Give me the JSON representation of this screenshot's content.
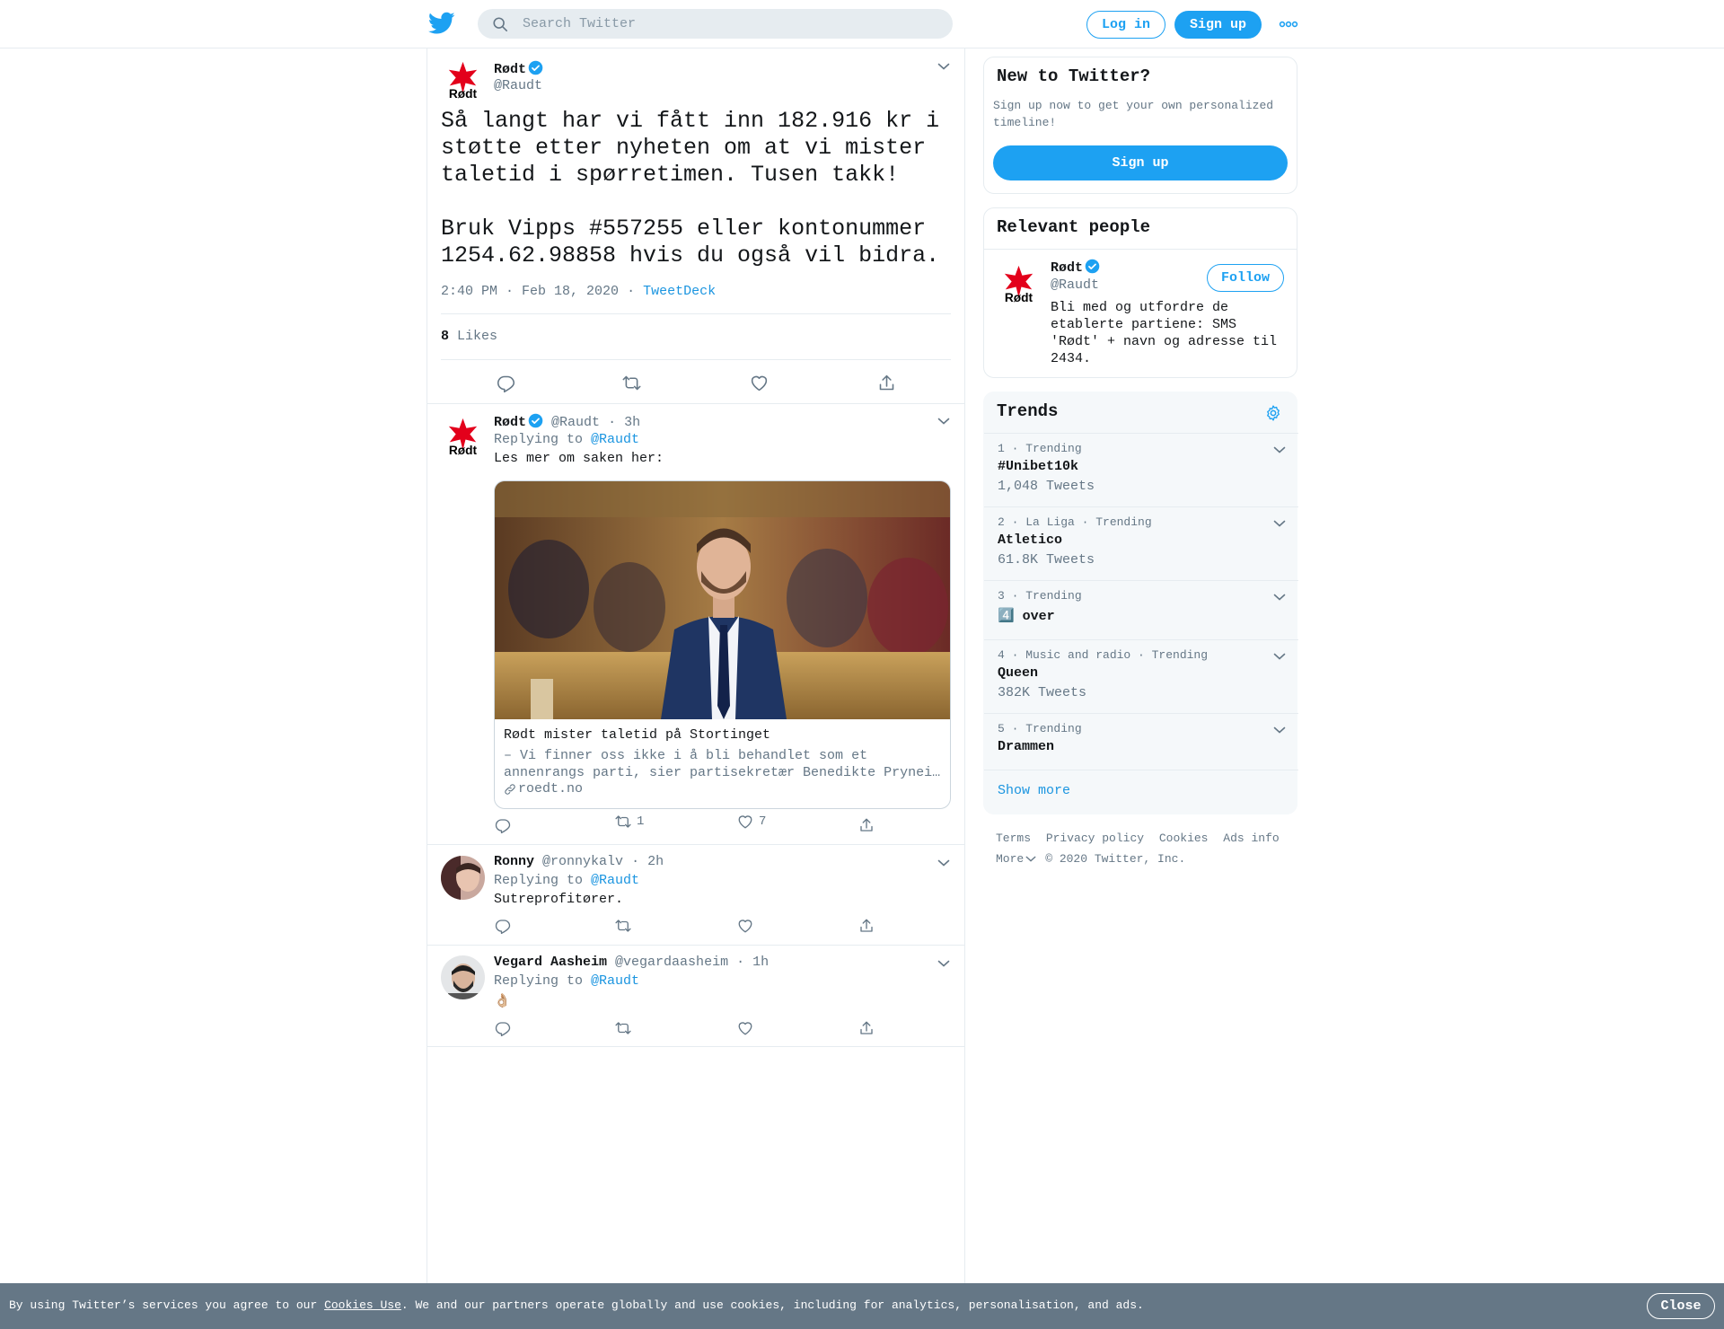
{
  "header": {
    "search_placeholder": "Search Twitter",
    "login_label": "Log in",
    "signup_label": "Sign up",
    "more_icon": "more-dots-icon"
  },
  "focused_tweet": {
    "author_name": "Rødt",
    "author_handle": "@Raudt",
    "text": "Så langt har vi fått inn 182.916 kr i\nstøtte etter nyheten om at vi mister\ntaletid i spørretimen. Tusen takk!\n\nBruk Vipps #557255 eller kontonummer\n1254.62.98858 hvis du også vil bidra.",
    "time": "2:40 PM · Feb 18, 2020",
    "separator": "·",
    "source": "TweetDeck",
    "likes_count": "8",
    "likes_label": "Likes"
  },
  "replies": [
    {
      "author_name": "Rødt",
      "author_handle": "@Raudt",
      "age": "· 3h",
      "replying_to_label": "Replying to",
      "replying_to": "@Raudt",
      "text": "Les mer om saken her:",
      "card": {
        "title": "Rødt mister taletid på Stortinget",
        "desc_line1": "– Vi finner oss ikke i å bli behandlet som et",
        "desc_line2": "annenrangs parti, sier partisekretær Benedikte Pryneid Hansen.",
        "domain": "roedt.no"
      },
      "retweets": "1",
      "likes": "7"
    },
    {
      "author_name": "Ronny",
      "author_handle": "@ronnykalv",
      "age": "· 2h",
      "replying_to_label": "Replying to",
      "replying_to": "@Raudt",
      "text": "Sutreprofitører."
    },
    {
      "author_name": "Vegard Aasheim",
      "author_handle": "@vegardaasheim",
      "age": "· 1h",
      "replying_to_label": "Replying to",
      "replying_to": "@Raudt",
      "text": "👌🏼"
    }
  ],
  "sidebar": {
    "new_to_twitter": {
      "title": "New to Twitter?",
      "desc": "Sign up now to get your own personalized timeline!",
      "button": "Sign up"
    },
    "relevant_people": {
      "title": "Relevant people",
      "name": "Rødt",
      "handle": "@Raudt",
      "follow_label": "Follow",
      "bio": "Bli med og utfordre de etablerte partiene: SMS 'Rødt' + navn og adresse til 2434."
    },
    "trends": {
      "title": "Trends",
      "items": [
        {
          "meta": "1 · Trending",
          "name": "#Unibet10k",
          "count": "1,048 Tweets"
        },
        {
          "meta": "2 · La Liga · Trending",
          "name": "Atletico",
          "count": "61.8K Tweets"
        },
        {
          "meta": "3 · Trending",
          "name": "4️⃣ over",
          "count": ""
        },
        {
          "meta": "4 · Music and radio · Trending",
          "name": "Queen",
          "count": "382K Tweets"
        },
        {
          "meta": "5 · Trending",
          "name": "Drammen",
          "count": ""
        }
      ],
      "show_more": "Show more"
    },
    "footer": {
      "terms": "Terms",
      "privacy": "Privacy policy",
      "cookies": "Cookies",
      "ads": "Ads info",
      "more": "More",
      "copyright": "© 2020 Twitter, Inc."
    }
  },
  "cookie_bar": {
    "text_before": "By using Twitter’s services you agree to our ",
    "link": "Cookies Use",
    "text_after": ". We and our partners operate globally and use cookies, including for analytics, personalisation, and ads.",
    "close": "Close"
  },
  "colors": {
    "brand": "#1da1f2",
    "link": "#1b95e0",
    "secondary_text": "#657786",
    "cookie_bar_bg": "#657786",
    "party_red": "#e3001b"
  }
}
